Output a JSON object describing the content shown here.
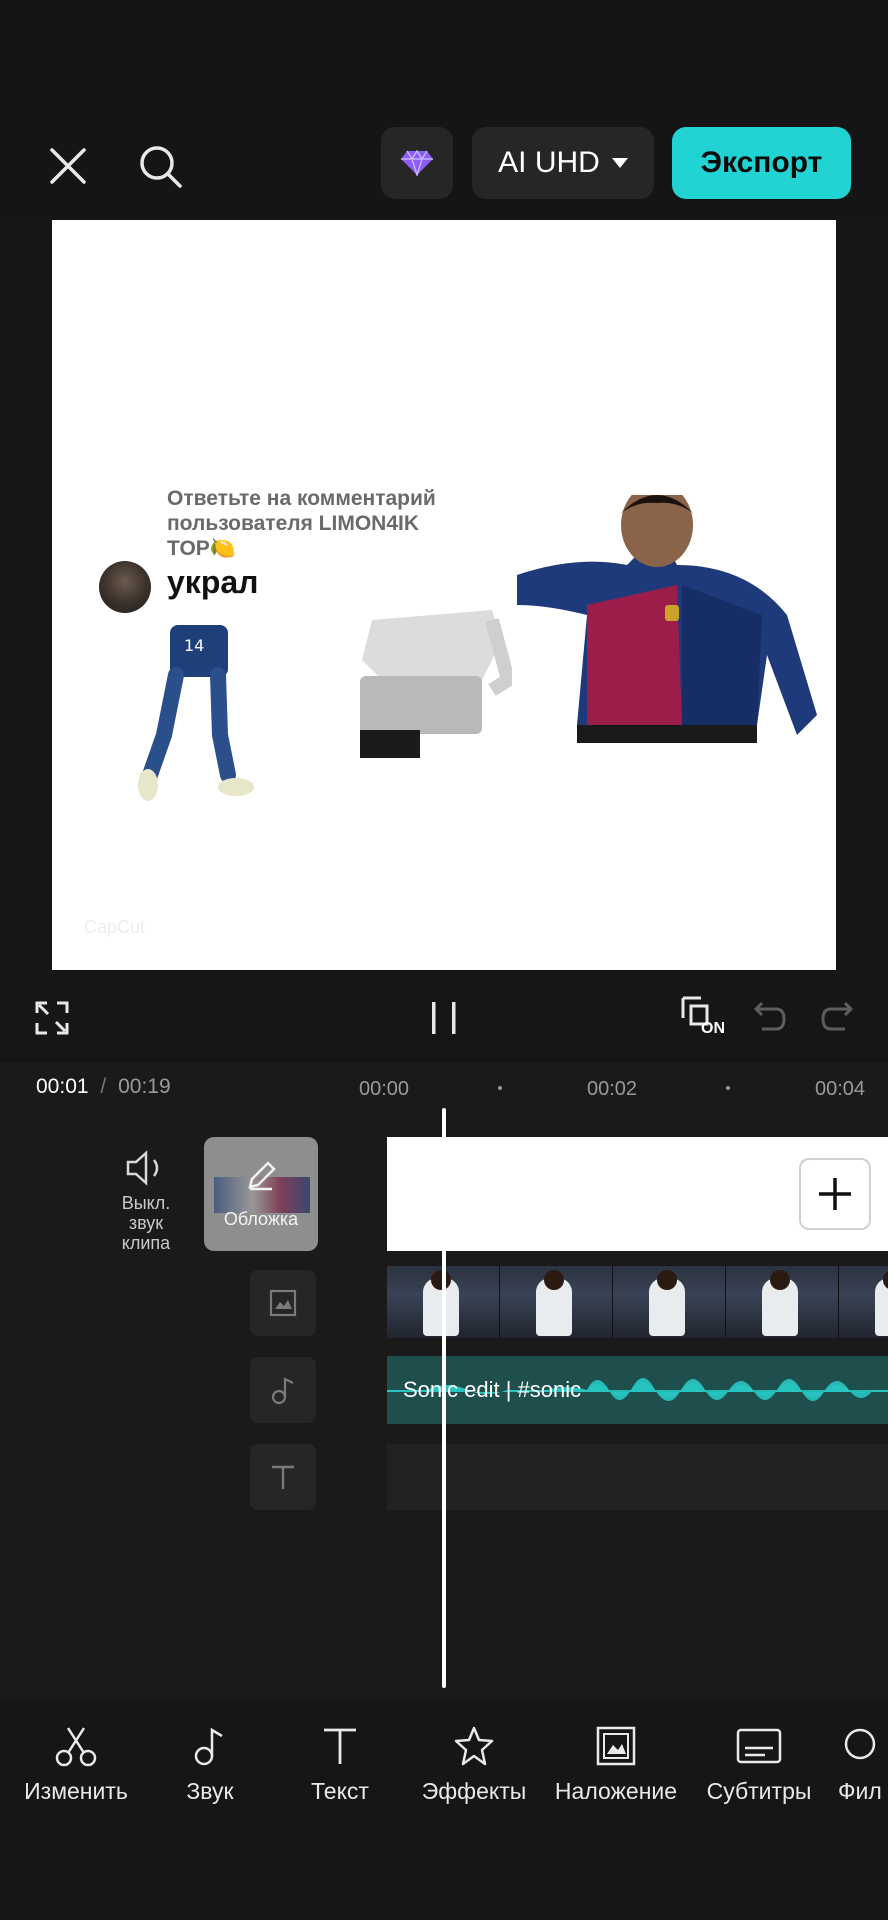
{
  "header": {
    "close_icon": "close-icon",
    "search_icon": "search-icon",
    "premium_icon": "diamond-icon",
    "quality_label": "AI UHD",
    "export_label": "Экспорт",
    "accent_color": "#22d3d3"
  },
  "preview": {
    "comment_line1": "Ответьте на комментарий",
    "comment_line2": "пользователя LIMON4IK",
    "comment_line3": "TOP🍋",
    "caption": "украл",
    "watermark": "CapCut"
  },
  "controls": {
    "fullscreen_icon": "fullscreen-icon",
    "play_pause_icon": "pause-icon",
    "keyframe_icon": "keyframe-on-icon",
    "keyframe_badge": "ON",
    "undo_icon": "undo-icon",
    "redo_icon": "redo-icon"
  },
  "timeline": {
    "current_time": "00:01",
    "separator": "/",
    "total_time": "00:19",
    "ruler": [
      "00:00",
      "00:02",
      "00:04"
    ],
    "mute_label_1": "Выкл.",
    "mute_label_2": "звук",
    "mute_label_3": "клипа",
    "cover_label": "Обложка",
    "audio_track_label": "Sonic edit | #sonic"
  },
  "toolbar": {
    "items": [
      {
        "label": "Изменить",
        "icon": "scissors-icon"
      },
      {
        "label": "Звук",
        "icon": "music-note-icon"
      },
      {
        "label": "Текст",
        "icon": "text-icon"
      },
      {
        "label": "Эффекты",
        "icon": "sparkle-star-icon"
      },
      {
        "label": "Наложение",
        "icon": "overlay-image-icon"
      },
      {
        "label": "Субтитры",
        "icon": "subtitles-icon"
      },
      {
        "label": "Фил",
        "icon": "filter-icon"
      }
    ]
  }
}
